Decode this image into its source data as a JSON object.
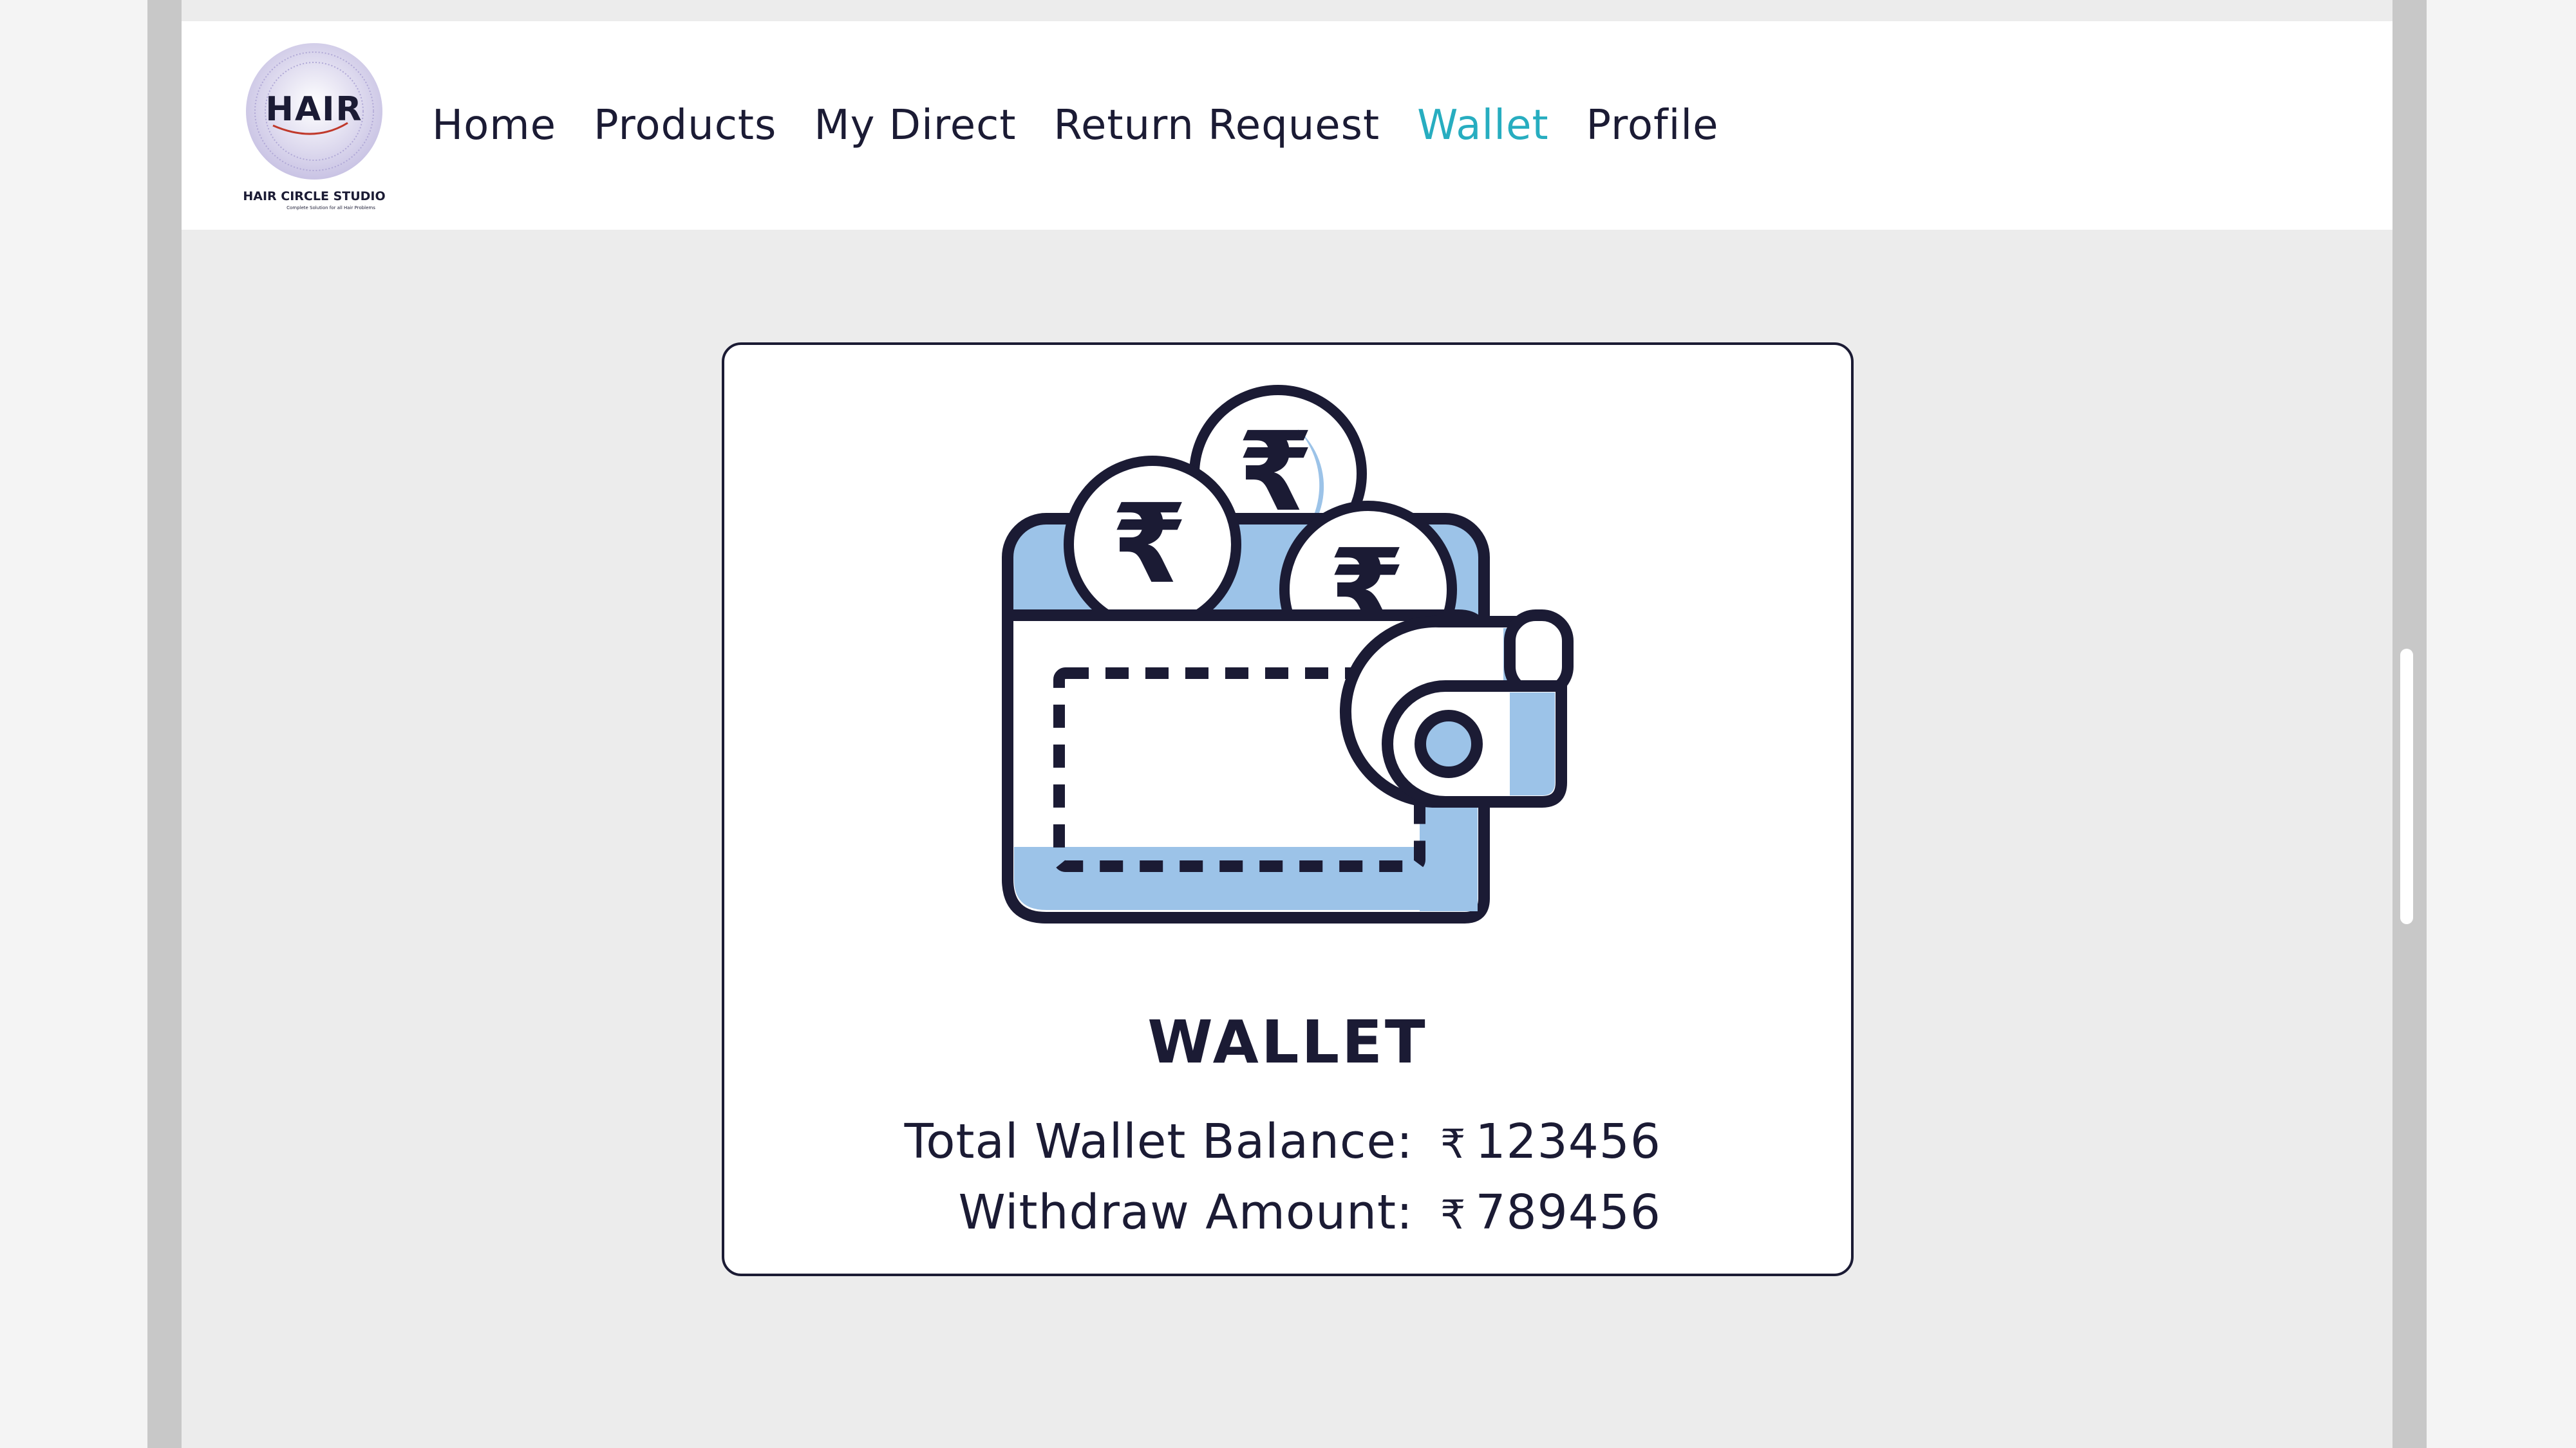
{
  "brand": {
    "logo_wordmark": "HAIR",
    "logo_caption": "HAIR CIRCLE STUDIO",
    "logo_tagline": "Complete Solution for all Hair Problems"
  },
  "nav": {
    "items": [
      {
        "label": "Home",
        "active": false
      },
      {
        "label": "Products",
        "active": false
      },
      {
        "label": "My Direct",
        "active": false
      },
      {
        "label": "Return Request",
        "active": false
      },
      {
        "label": "Wallet",
        "active": true
      },
      {
        "label": "Profile",
        "active": false
      }
    ],
    "active_color": "#27adc0",
    "text_color": "#1b1b34"
  },
  "wallet": {
    "illustration_icon": "wallet-with-rupee-coins-icon",
    "title": "WALLET",
    "currency_symbol": "₹",
    "total_balance_label": "Total Wallet Balance:",
    "total_balance_value": "123456",
    "withdraw_label": "Withdraw Amount:",
    "withdraw_value": "789456"
  },
  "colors": {
    "accent_blue": "#9cc3e8",
    "ink": "#1b1b34",
    "page_bg": "#ececec"
  }
}
